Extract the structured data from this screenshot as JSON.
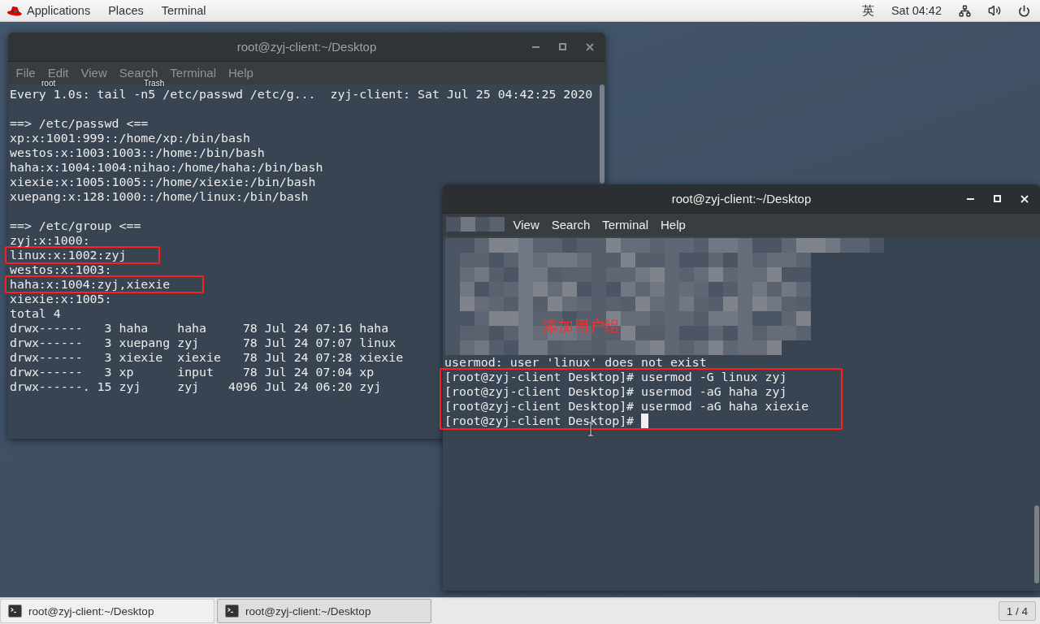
{
  "top_bar": {
    "menus": [
      "Applications",
      "Places",
      "Terminal"
    ],
    "input_method": "英",
    "clock": "Sat 04:42"
  },
  "desktop_icons": [
    {
      "label": "root"
    },
    {
      "label": "Trash"
    }
  ],
  "windows": [
    {
      "title": "root@zyj-client:~/Desktop",
      "active": false,
      "redacted": false,
      "cursor_visible": false,
      "menu": [
        "File",
        "Edit",
        "View",
        "Search",
        "Terminal",
        "Help"
      ],
      "blocks": [
        {
          "segments": [
            {
              "kind": "plain",
              "lines": [
                "Every 1.0s: tail -n5 /etc/passwd /etc/g...  zyj-client: Sat Jul 25 04:42:25 2020"
              ]
            }
          ]
        },
        {
          "segments": [
            {
              "kind": "plain",
              "lines": [
                "==> /etc/passwd <==",
                "xp:x:1001:999::/home/xp:/bin/bash",
                "westos:x:1003:1003::/home:/bin/bash",
                "haha:x:1004:1004:nihao:/home/haha:/bin/bash",
                "xiexie:x:1005:1005::/home/xiexie:/bin/bash",
                "xuepang:x:128:1000::/home/linux:/bin/bash"
              ]
            }
          ]
        },
        {
          "segments": [
            {
              "kind": "plain",
              "lines": [
                "==> /etc/group <==",
                "zyj:x:1000:"
              ]
            },
            {
              "kind": "boxed",
              "lines": [
                "linux:x:1002:zyj"
              ]
            },
            {
              "kind": "plain",
              "lines": [
                "westos:x:1003:"
              ]
            },
            {
              "kind": "boxed",
              "lines": [
                "haha:x:1004:zyj,xiexie"
              ]
            },
            {
              "kind": "plain",
              "lines": [
                "xiexie:x:1005:",
                "total 4",
                "drwx------   3 haha    haha     78 Jul 24 07:16 haha",
                "drwx------   3 xuepang zyj      78 Jul 24 07:07 linux",
                "drwx------   3 xiexie  xiexie   78 Jul 24 07:28 xiexie",
                "drwx------   3 xp      input    78 Jul 24 07:04 xp",
                "drwx------. 15 zyj     zyj    4096 Jul 24 06:20 zyj"
              ]
            }
          ]
        }
      ]
    },
    {
      "title": "root@zyj-client:~/Desktop",
      "active": true,
      "redacted": true,
      "cursor_visible": true,
      "menu": [
        "View",
        "Search",
        "Terminal",
        "Help"
      ],
      "annotation": "添加用户组",
      "blocks": [
        {
          "segments": [
            {
              "kind": "plain",
              "lines": [
                "usermod: user 'linux' does not exist"
              ]
            },
            {
              "kind": "boxed",
              "lines": [
                "[root@zyj-client Desktop]# usermod -G linux zyj",
                "[root@zyj-client Desktop]# usermod -aG haha zyj",
                "[root@zyj-client Desktop]# usermod -aG haha xiexie",
                "[root@zyj-client Desktop]#"
              ]
            }
          ]
        }
      ]
    }
  ],
  "taskbar": {
    "tasks": [
      {
        "title": "root@zyj-client:~/Desktop",
        "selected": false
      },
      {
        "title": "root@zyj-client:~/Desktop",
        "selected": true
      }
    ],
    "workspace": "1 / 4"
  }
}
